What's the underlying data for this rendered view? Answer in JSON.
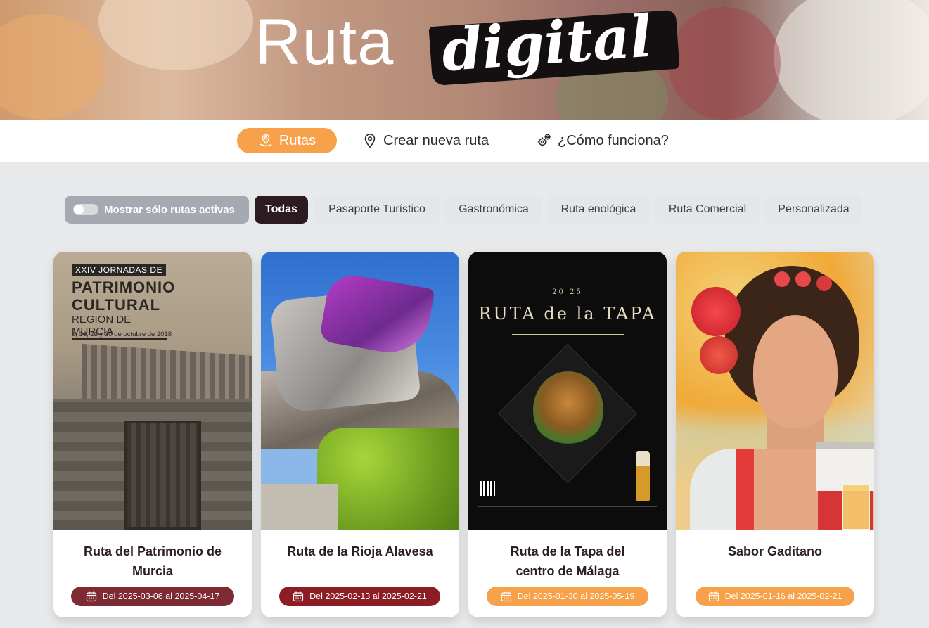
{
  "hero": {
    "title_light": "Ruta",
    "title_script": "digital"
  },
  "nav": {
    "items": [
      {
        "label": "Rutas",
        "icon": "map-pin-hand-icon",
        "active": true
      },
      {
        "label": "Crear nueva ruta",
        "icon": "map-pin-icon",
        "active": false
      },
      {
        "label": "¿Cómo funciona?",
        "icon": "gears-icon",
        "active": false
      }
    ],
    "active_color": "#f7a14b"
  },
  "filters": {
    "toggle_label": "Mostrar sólo rutas activas",
    "toggle_on": false,
    "chips": [
      {
        "label": "Todas",
        "active": true
      },
      {
        "label": "Pasaporte Turístico",
        "active": false
      },
      {
        "label": "Gastronómica",
        "active": false
      },
      {
        "label": "Ruta enológica",
        "active": false
      },
      {
        "label": "Ruta Comercial",
        "active": false
      },
      {
        "label": "Personalizada",
        "active": false
      }
    ]
  },
  "cards": [
    {
      "title": "Ruta del Patrimonio de Murcia",
      "date": "Del 2025-03-06 al 2025-04-17",
      "badge_color": "#7e2a33",
      "image": {
        "tag": "XXIV JORNADAS DE",
        "line1": "PATRIMONIO",
        "line2": "CULTURAL",
        "region": "REGIÓN DE MURCIA",
        "dates": "9, 16, 23 y 30 de octubre de 2018"
      }
    },
    {
      "title": "Ruta de la Rioja Alavesa",
      "date": "Del 2025-02-13 al 2025-02-21",
      "badge_color": "#8c1d24"
    },
    {
      "title": "Ruta de la Tapa del centro de Málaga",
      "date": "Del 2025-01-30 al 2025-05-19",
      "badge_color": "#f7a14b",
      "image": {
        "year": "20 25",
        "headline": "RUTA de la TAPA"
      }
    },
    {
      "title": "Sabor Gaditano",
      "date": "Del 2025-01-16 al 2025-02-21",
      "badge_color": "#f7a14b"
    }
  ]
}
